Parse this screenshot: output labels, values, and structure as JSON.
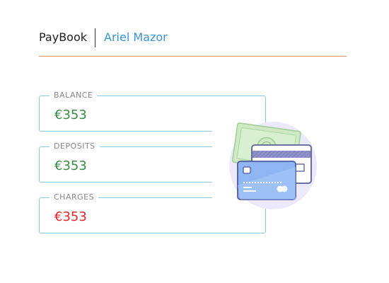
{
  "header": {
    "app_name": "PayBook",
    "user_name": "Ariel Mazor"
  },
  "cards": {
    "balance": {
      "label": "BALANCE",
      "value": "€353"
    },
    "deposits": {
      "label": "DEPOSITS",
      "value": "€353"
    },
    "charges": {
      "label": "CHARGES",
      "value": "€353"
    }
  },
  "colors": {
    "accent_rule": "#e3915a",
    "link": "#3a93d8",
    "positive": "#3c8a45",
    "negative": "#e8242a",
    "card_border": "#8ec9e3"
  },
  "illustration": {
    "icon": "credit-cards-and-cash-icon"
  }
}
